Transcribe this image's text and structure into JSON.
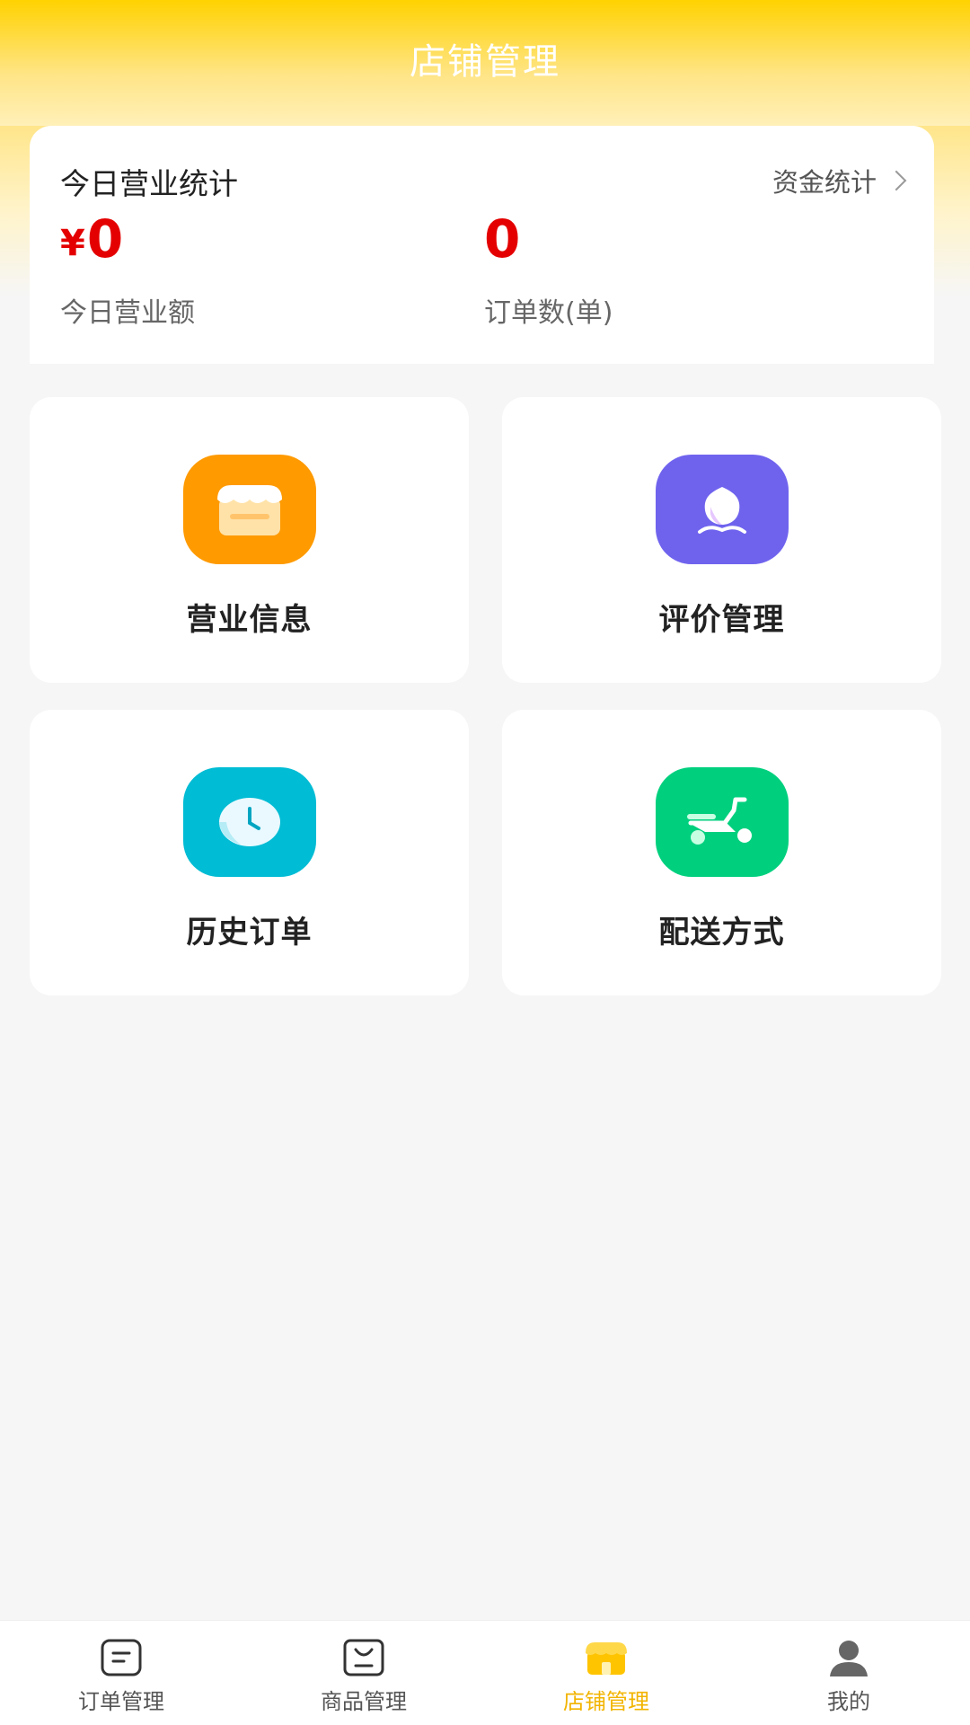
{
  "header": {
    "title": "店铺管理"
  },
  "stats": {
    "title": "今日营业统计",
    "link": "资金统计",
    "revenue": {
      "currency": "¥",
      "value": "0",
      "label": "今日营业额"
    },
    "orders": {
      "value": "0",
      "label": "订单数(单)"
    },
    "value_color": "#e40000"
  },
  "cards": [
    {
      "label": "营业信息",
      "icon": "storefront-icon",
      "color": "#ff9a00"
    },
    {
      "label": "评价管理",
      "icon": "flower-icon",
      "color": "#6f63ee"
    },
    {
      "label": "历史订单",
      "icon": "clock-icon",
      "color": "#00bcd4"
    },
    {
      "label": "配送方式",
      "icon": "scooter-icon",
      "color": "#00d07e"
    }
  ],
  "tabbar": {
    "items": [
      {
        "label": "订单管理",
        "icon": "order-list-icon",
        "active": false
      },
      {
        "label": "商品管理",
        "icon": "goods-box-icon",
        "active": false
      },
      {
        "label": "店铺管理",
        "icon": "store-icon",
        "active": true
      },
      {
        "label": "我的",
        "icon": "user-icon",
        "active": false
      }
    ],
    "active_color": "#f2b400"
  }
}
